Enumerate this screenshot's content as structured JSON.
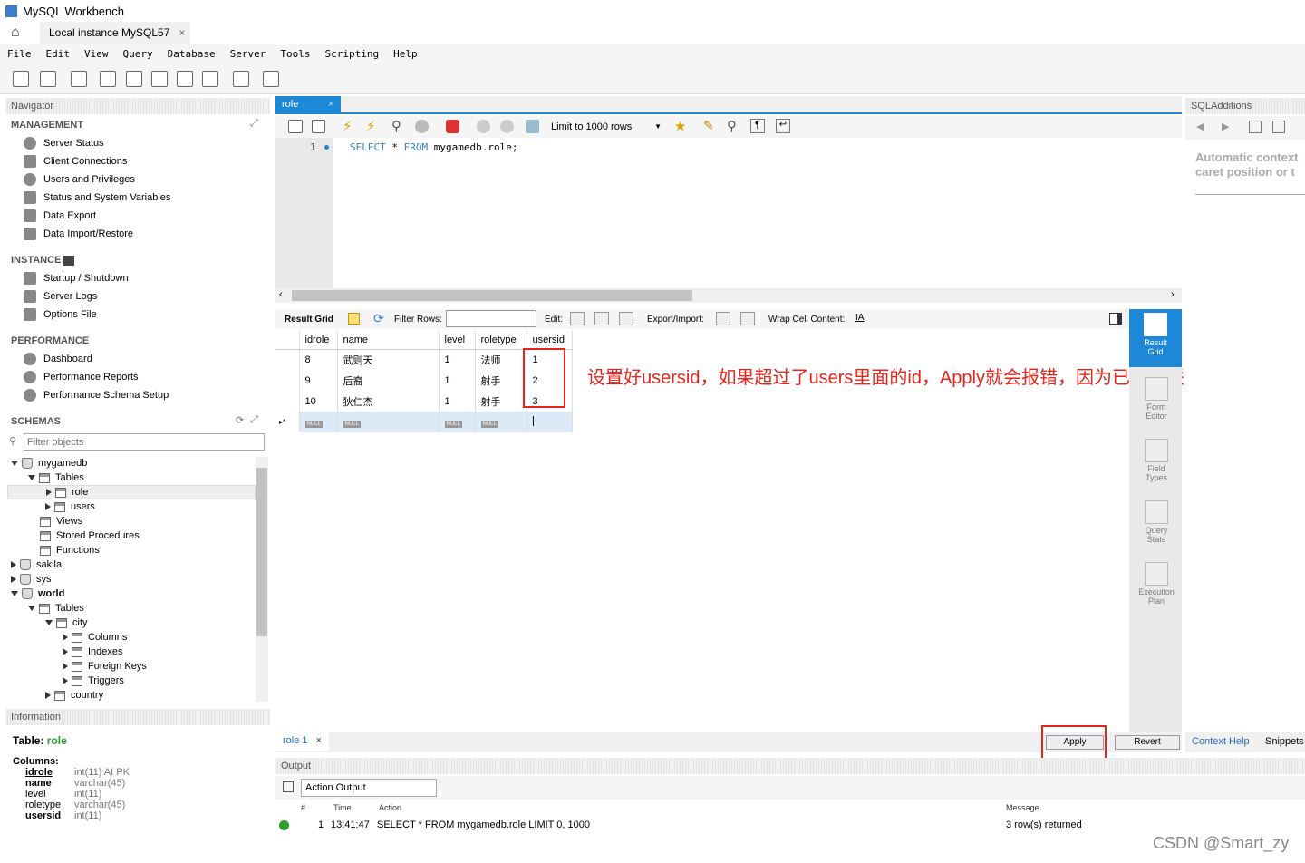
{
  "window": {
    "title": "MySQL Workbench"
  },
  "tabs": [
    {
      "label": "Local instance MySQL57"
    }
  ],
  "menu": [
    "File",
    "Edit",
    "View",
    "Query",
    "Database",
    "Server",
    "Tools",
    "Scripting",
    "Help"
  ],
  "navigator": {
    "title": "Navigator",
    "management": {
      "title": "MANAGEMENT",
      "items": [
        "Server Status",
        "Client Connections",
        "Users and Privileges",
        "Status and System Variables",
        "Data Export",
        "Data Import/Restore"
      ]
    },
    "instance": {
      "title": "INSTANCE",
      "items": [
        "Startup / Shutdown",
        "Server Logs",
        "Options File"
      ]
    },
    "performance": {
      "title": "PERFORMANCE",
      "items": [
        "Dashboard",
        "Performance Reports",
        "Performance Schema Setup"
      ]
    },
    "schemas": {
      "title": "SCHEMAS",
      "filter_placeholder": "Filter objects",
      "tree": [
        "mygamedb",
        "Tables",
        "role",
        "users",
        "Views",
        "Stored Procedures",
        "Functions",
        "sakila",
        "sys",
        "world",
        "Tables",
        "city",
        "Columns",
        "Indexes",
        "Foreign Keys",
        "Triggers",
        "country"
      ]
    }
  },
  "information": {
    "title": "Information",
    "table_label": "Table:",
    "table_name": "role",
    "columns_label": "Columns:",
    "columns": [
      {
        "name": "idrole",
        "type": "int(11) AI PK"
      },
      {
        "name": "name",
        "type": "varchar(45)"
      },
      {
        "name": "level",
        "type": "int(11)"
      },
      {
        "name": "roletype",
        "type": "varchar(45)"
      },
      {
        "name": "usersid",
        "type": "int(11)"
      }
    ]
  },
  "editor": {
    "tab": "role",
    "limit": "Limit to 1000 rows",
    "line_number": "1",
    "sql_keyword1": "SELECT",
    "sql_star": "*",
    "sql_keyword2": "FROM",
    "sql_rest": "mygamedb.role;"
  },
  "result_toolbar": {
    "result_grid": "Result Grid",
    "filter_rows": "Filter Rows:",
    "edit": "Edit:",
    "export_import": "Export/Import:",
    "wrap": "Wrap Cell Content:"
  },
  "grid": {
    "columns": [
      "idrole",
      "name",
      "level",
      "roletype",
      "usersid"
    ],
    "rows": [
      [
        "8",
        "武则天",
        "1",
        "法师",
        "1"
      ],
      [
        "9",
        "后裔",
        "1",
        "射手",
        "2"
      ],
      [
        "10",
        "狄仁杰",
        "1",
        "射手",
        "3"
      ]
    ],
    "null_label": "NULL"
  },
  "annotation": "设置好usersid，如果超过了users里面的id，Apply就会报错，因为已经关联起来了",
  "side_buttons": [
    {
      "label1": "Result",
      "label2": "Grid"
    },
    {
      "label1": "Form",
      "label2": "Editor"
    },
    {
      "label1": "Field",
      "label2": "Types"
    },
    {
      "label1": "Query",
      "label2": "Stats"
    },
    {
      "label1": "Execution",
      "label2": "Plan"
    }
  ],
  "bottom_tab": "role 1",
  "apply": "Apply",
  "revert": "Revert",
  "output": {
    "title": "Output",
    "selector": "Action Output",
    "headers": {
      "num": "#",
      "time": "Time",
      "action": "Action",
      "message": "Message"
    },
    "row": {
      "num": "1",
      "time": "13:41:47",
      "action": "SELECT * FROM mygamedb.role LIMIT 0, 1000",
      "message": "3 row(s) returned"
    }
  },
  "sqladditions": {
    "title": "SQLAdditions",
    "text": "Automatic context help is disabled. Use the toolbar to manually get help for the current caret position or to toggle automatic help.",
    "line1": "Automatic context",
    "line2": "caret position or t",
    "tab_context": "Context Help",
    "tab_snippets": "Snippets"
  },
  "watermark": "CSDN @Smart_zy",
  "colors": {
    "accent": "#1e88d8",
    "annotation": "#e8241a",
    "keyword": "#3c7ec8"
  }
}
